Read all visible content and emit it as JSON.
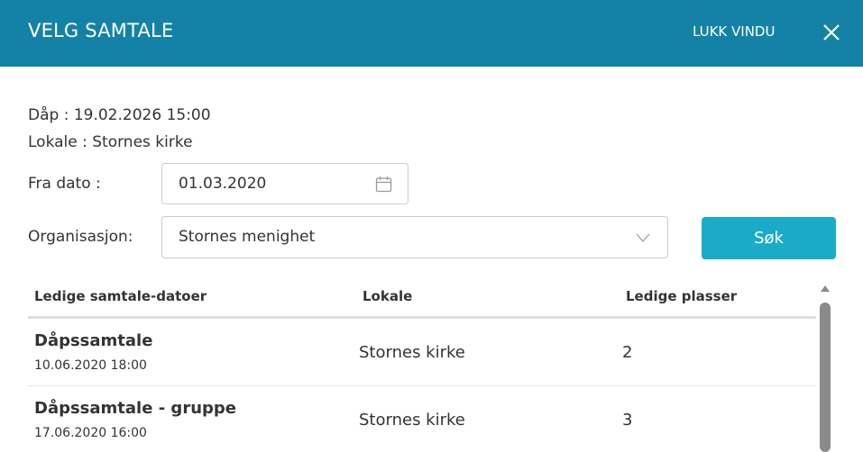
{
  "header": {
    "title": "VELG SAMTALE",
    "close_label": "LUKK VINDU",
    "close_icon": "close-icon"
  },
  "info": {
    "line1": "Dåp : 19.02.2026 15:00",
    "line2": "Lokale : Stornes kirke"
  },
  "form": {
    "date_label": "Fra dato :",
    "date_value": "01.03.2020",
    "org_label": "Organisasjon:",
    "org_value": "Stornes menighet",
    "search_label": "Søk"
  },
  "table": {
    "headers": [
      "Ledige samtale-datoer",
      "Lokale",
      "Ledige plasser"
    ],
    "rows": [
      {
        "name": "Dåpssamtale",
        "datetime": "10.06.2020 18:00",
        "location": "Stornes kirke",
        "places": "2"
      },
      {
        "name": "Dåpssamtale - gruppe",
        "datetime": "17.06.2020 16:00",
        "location": "Stornes kirke",
        "places": "3"
      }
    ]
  },
  "colors": {
    "header_bg": "#1482a6",
    "button_bg": "#1aabc9"
  }
}
